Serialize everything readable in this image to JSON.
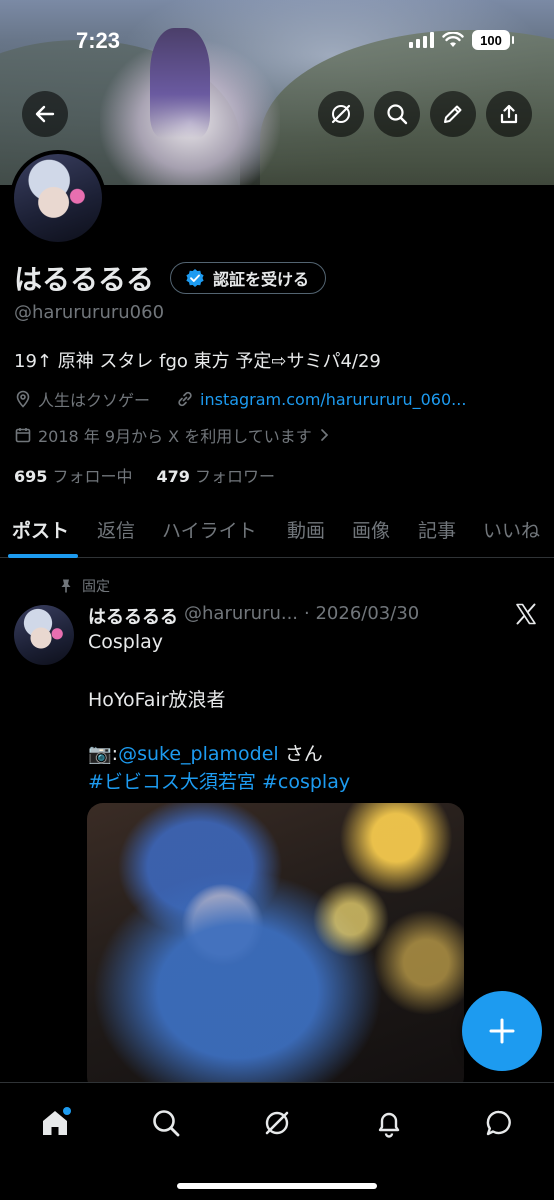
{
  "status_bar": {
    "time": "7:23",
    "battery": "100"
  },
  "header": {
    "back_icon": "arrow-left-icon",
    "buttons": [
      "grok-icon",
      "search-icon",
      "edit-icon",
      "share-icon"
    ]
  },
  "profile": {
    "name": "はるるるる",
    "verify_label": "認証を受ける",
    "handle": "@harurururu060",
    "bio": "19↑ 原神 スタレ fgo 東方 予定⇨サミパ4/29",
    "location": "人生はクソゲー",
    "link": "instagram.com/harurururu_060...",
    "joined": "2018 年 9月から X を利用しています",
    "following_count": "695",
    "following_label": "フォロー中",
    "followers_count": "479",
    "followers_label": "フォロワー"
  },
  "tabs": [
    "ポスト",
    "返信",
    "ハイライト",
    "動画",
    "画像",
    "記事",
    "いいね"
  ],
  "post": {
    "pinned_label": "固定",
    "author": "はるるるる",
    "handle": "@harururu...",
    "date": "· 2026/03/30",
    "line1": "Cosplay",
    "line2": "HoYoFair放浪者",
    "camera": "📷:",
    "mention": "@suke_plamodel",
    "mention_suffix": " さん",
    "hashtags": "#ビビコス大須若宮 #cosplay"
  },
  "bottom_nav": [
    "home-icon",
    "search-icon",
    "grok-icon",
    "notifications-icon",
    "messages-icon"
  ],
  "colors": {
    "accent": "#1d9bf0",
    "muted": "#71767b",
    "text": "#e7e9ea",
    "background": "#000000"
  }
}
